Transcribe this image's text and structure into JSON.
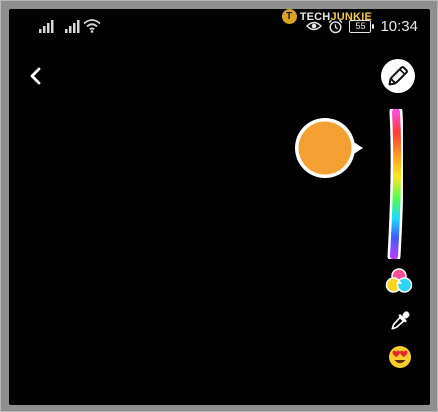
{
  "status_bar": {
    "time": "10:34",
    "battery": "55",
    "icons": [
      "signal-icon",
      "signal-icon",
      "wifi-icon",
      "eye-icon",
      "alarm-icon",
      "battery-icon"
    ]
  },
  "watermark": {
    "logo_letter": "T",
    "tech": "TECH",
    "junkie": "JUNKIE"
  },
  "toolbar": {
    "back_icon": "chevron-left-icon",
    "pencil_icon": "pencil-icon"
  },
  "color_picker": {
    "selected_color": "#f5a033",
    "slider_colors": [
      "#ff4fd8",
      "#ff3b3b",
      "#ff9a1f",
      "#ffe81f",
      "#4dff4d",
      "#1fd9ff",
      "#3f5bff",
      "#b03fff"
    ],
    "tools": [
      "color-palette-icon",
      "eyedropper-icon",
      "emoji-icon"
    ]
  }
}
